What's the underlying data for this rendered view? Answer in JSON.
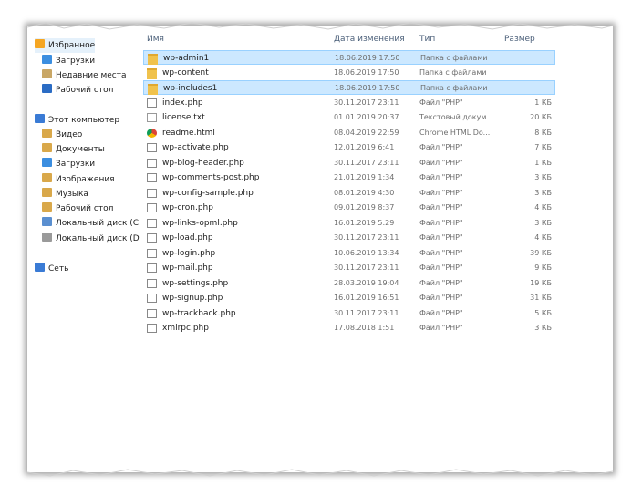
{
  "sidebar": {
    "items": [
      {
        "label": "Избранное",
        "icon": "star-icon",
        "color": "#f5a623",
        "sub": false
      },
      {
        "label": "Загрузки",
        "icon": "downloads-folder-icon",
        "color": "#3b8ee0",
        "sub": true
      },
      {
        "label": "Недавние места",
        "icon": "recent-places-icon",
        "color": "#c9a766",
        "sub": true
      },
      {
        "label": "Рабочий стол",
        "icon": "desktop-icon",
        "color": "#2b6cc4",
        "sub": true
      },
      {
        "label": "Этот компьютер",
        "icon": "computer-icon",
        "color": "#3a7bd5",
        "sub": false
      },
      {
        "label": "Видео",
        "icon": "video-folder-icon",
        "color": "#d9a84a",
        "sub": true
      },
      {
        "label": "Документы",
        "icon": "documents-folder-icon",
        "color": "#d9a84a",
        "sub": true
      },
      {
        "label": "Загрузки",
        "icon": "downloads-folder-icon",
        "color": "#3b8ee0",
        "sub": true
      },
      {
        "label": "Изображения",
        "icon": "pictures-folder-icon",
        "color": "#d9a84a",
        "sub": true
      },
      {
        "label": "Музыка",
        "icon": "music-folder-icon",
        "color": "#d9a84a",
        "sub": true
      },
      {
        "label": "Рабочий стол",
        "icon": "desktop-icon",
        "color": "#d9a84a",
        "sub": true
      },
      {
        "label": "Локальный диск (C",
        "icon": "drive-c-icon",
        "color": "#5a8fd0",
        "sub": true
      },
      {
        "label": "Локальный диск (D",
        "icon": "drive-d-icon",
        "color": "#9a9a9a",
        "sub": true
      },
      {
        "label": "Сеть",
        "icon": "network-icon",
        "color": "#3a7bd5",
        "sub": false
      }
    ]
  },
  "columns": {
    "name": "Имя",
    "date": "Дата изменения",
    "type": "Тип",
    "size": "Размер"
  },
  "files": [
    {
      "name": "wp-admin1",
      "date": "18.06.2019 17:50",
      "type": "Папка с файлами",
      "size": "",
      "kind": "folder",
      "selected": true
    },
    {
      "name": "wp-content",
      "date": "18.06.2019 17:50",
      "type": "Папка с файлами",
      "size": "",
      "kind": "folder",
      "selected": false
    },
    {
      "name": "wp-includes1",
      "date": "18.06.2019 17:50",
      "type": "Папка с файлами",
      "size": "",
      "kind": "folder",
      "selected": true
    },
    {
      "name": "index.php",
      "date": "30.11.2017 23:11",
      "type": "Файл \"PHP\"",
      "size": "1 КБ",
      "kind": "php",
      "selected": false
    },
    {
      "name": "license.txt",
      "date": "01.01.2019 20:37",
      "type": "Текстовый докум...",
      "size": "20 КБ",
      "kind": "txt",
      "selected": false
    },
    {
      "name": "readme.html",
      "date": "08.04.2019 22:59",
      "type": "Chrome HTML Do...",
      "size": "8 КБ",
      "kind": "chrome",
      "selected": false
    },
    {
      "name": "wp-activate.php",
      "date": "12.01.2019 6:41",
      "type": "Файл \"PHP\"",
      "size": "7 КБ",
      "kind": "php",
      "selected": false
    },
    {
      "name": "wp-blog-header.php",
      "date": "30.11.2017 23:11",
      "type": "Файл \"PHP\"",
      "size": "1 КБ",
      "kind": "php",
      "selected": false
    },
    {
      "name": "wp-comments-post.php",
      "date": "21.01.2019 1:34",
      "type": "Файл \"PHP\"",
      "size": "3 КБ",
      "kind": "php",
      "selected": false
    },
    {
      "name": "wp-config-sample.php",
      "date": "08.01.2019 4:30",
      "type": "Файл \"PHP\"",
      "size": "3 КБ",
      "kind": "php",
      "selected": false
    },
    {
      "name": "wp-cron.php",
      "date": "09.01.2019 8:37",
      "type": "Файл \"PHP\"",
      "size": "4 КБ",
      "kind": "php",
      "selected": false
    },
    {
      "name": "wp-links-opml.php",
      "date": "16.01.2019 5:29",
      "type": "Файл \"PHP\"",
      "size": "3 КБ",
      "kind": "php",
      "selected": false
    },
    {
      "name": "wp-load.php",
      "date": "30.11.2017 23:11",
      "type": "Файл \"PHP\"",
      "size": "4 КБ",
      "kind": "php",
      "selected": false
    },
    {
      "name": "wp-login.php",
      "date": "10.06.2019 13:34",
      "type": "Файл \"PHP\"",
      "size": "39 КБ",
      "kind": "php",
      "selected": false
    },
    {
      "name": "wp-mail.php",
      "date": "30.11.2017 23:11",
      "type": "Файл \"PHP\"",
      "size": "9 КБ",
      "kind": "php",
      "selected": false
    },
    {
      "name": "wp-settings.php",
      "date": "28.03.2019 19:04",
      "type": "Файл \"PHP\"",
      "size": "19 КБ",
      "kind": "php",
      "selected": false
    },
    {
      "name": "wp-signup.php",
      "date": "16.01.2019 16:51",
      "type": "Файл \"PHP\"",
      "size": "31 КБ",
      "kind": "php",
      "selected": false
    },
    {
      "name": "wp-trackback.php",
      "date": "30.11.2017 23:11",
      "type": "Файл \"PHP\"",
      "size": "5 КБ",
      "kind": "php",
      "selected": false
    },
    {
      "name": "xmlrpc.php",
      "date": "17.08.2018 1:51",
      "type": "Файл \"PHP\"",
      "size": "3 КБ",
      "kind": "php",
      "selected": false
    }
  ],
  "colors": {
    "selection_bg": "#cce8ff",
    "selection_border": "#99d1ff",
    "header_text": "#4c607a",
    "folder": "#f0c24c"
  }
}
